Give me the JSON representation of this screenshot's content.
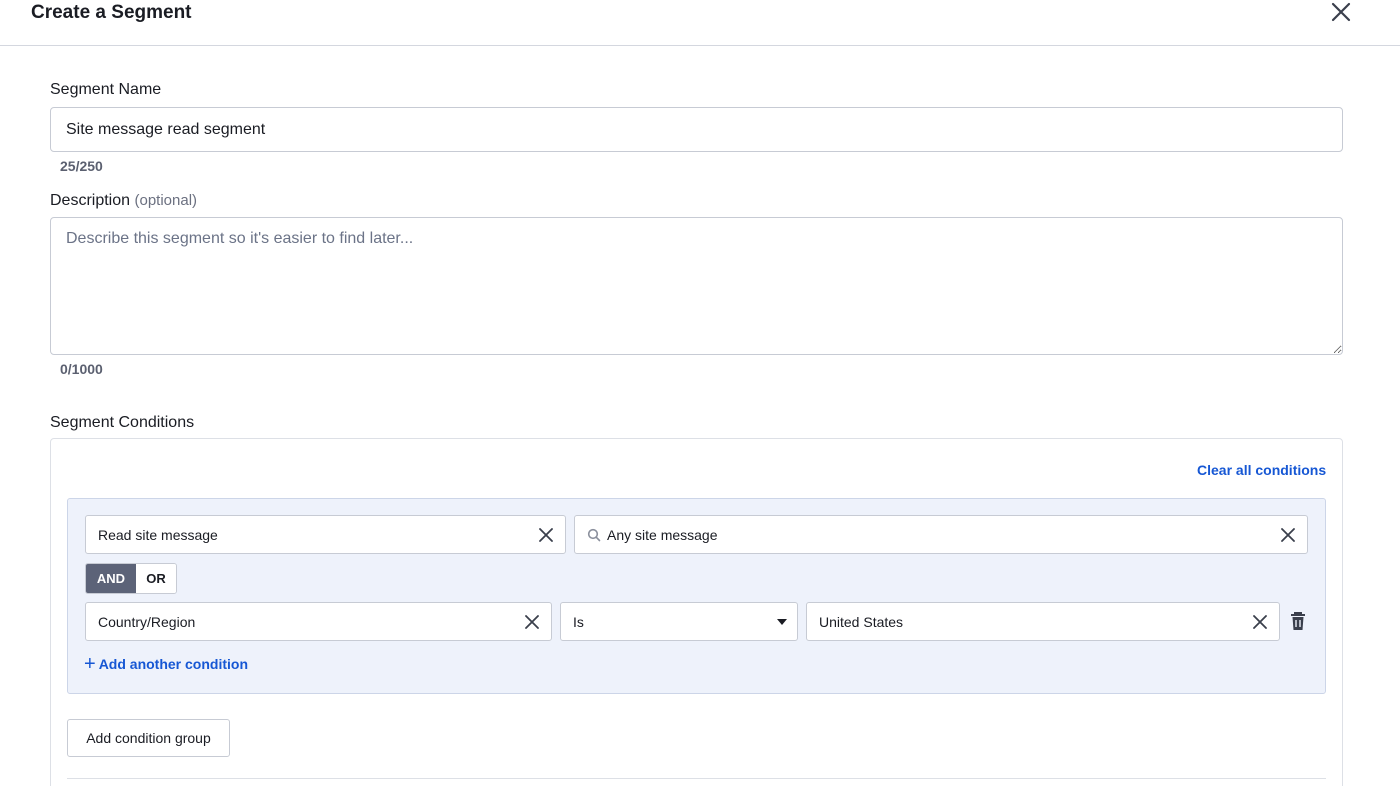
{
  "header": {
    "title": "Create a Segment",
    "close_icon": "close-icon"
  },
  "name_field": {
    "label": "Segment Name",
    "value": "Site message read segment",
    "counter": "25/250"
  },
  "description_field": {
    "label": "Description",
    "optional": "(optional)",
    "placeholder": "Describe this segment so it's easier to find later...",
    "value": "",
    "counter": "0/1000"
  },
  "conditions": {
    "label": "Segment Conditions",
    "clear_all": "Clear all conditions",
    "group": {
      "row1": {
        "event": "Read site message",
        "target": "Any site message"
      },
      "logic": {
        "and": "AND",
        "or": "OR",
        "selected": "AND"
      },
      "row2": {
        "property": "Country/Region",
        "operator": "Is",
        "value": "United States"
      },
      "add_condition": "Add another condition"
    },
    "add_group": "Add condition group"
  },
  "colors": {
    "link": "#1657d4",
    "toggle_active": "#5c6378",
    "group_bg": "#eef2fb"
  }
}
